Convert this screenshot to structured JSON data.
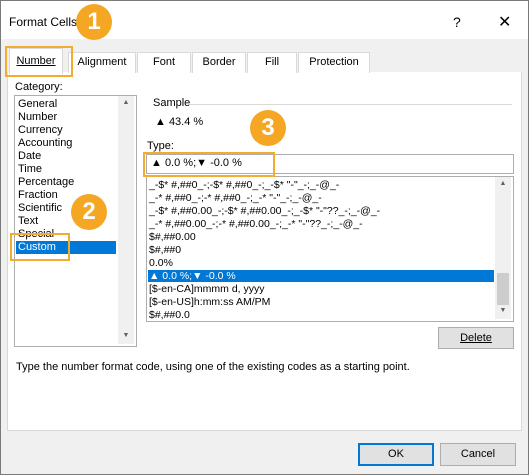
{
  "dialog": {
    "title": "Format Cells",
    "help_glyph": "?",
    "close_glyph": "✕"
  },
  "tabs": [
    {
      "label": "Number",
      "active": true
    },
    {
      "label": "Alignment"
    },
    {
      "label": "Font"
    },
    {
      "label": "Border"
    },
    {
      "label": "Fill"
    },
    {
      "label": "Protection"
    }
  ],
  "category": {
    "label": "Category:",
    "items": [
      "General",
      "Number",
      "Currency",
      "Accounting",
      "Date",
      "Time",
      "Percentage",
      "Fraction",
      "Scientific",
      "Text",
      "Special",
      "Custom"
    ],
    "selected": "Custom"
  },
  "sample": {
    "label": "Sample",
    "value": "▲ 43.4 %"
  },
  "type": {
    "label": "Type:",
    "input_value": "▲ 0.0 %;▼ -0.0 %",
    "formats": [
      "_-$* #,##0_-;-$* #,##0_-;_-$* \"-\"_-;_-@_-",
      "_-* #,##0_-;-* #,##0_-;_-* \"-\"_-;_-@_-",
      "_-$* #,##0.00_-;-$* #,##0.00_-;_-$* \"-\"??_-;_-@_-",
      "_-* #,##0.00_-;-* #,##0.00_-;_-* \"-\"??_-;_-@_-",
      "$#,##0.00",
      "$#,##0",
      "0.0%",
      "▲ 0.0 %;▼ -0.0 %",
      "[$-en-CA]mmmm d, yyyy",
      "[$-en-US]h:mm:ss AM/PM",
      "$#,##0.0"
    ],
    "selected_format": "▲ 0.0 %;▼ -0.0 %"
  },
  "buttons": {
    "delete": "Delete",
    "ok": "OK",
    "cancel": "Cancel"
  },
  "description": "Type the number format code, using one of the existing codes as a starting point.",
  "callouts": [
    "1",
    "2",
    "3"
  ],
  "colors": {
    "accent": "#0078d7",
    "callout": "#f5a623"
  }
}
